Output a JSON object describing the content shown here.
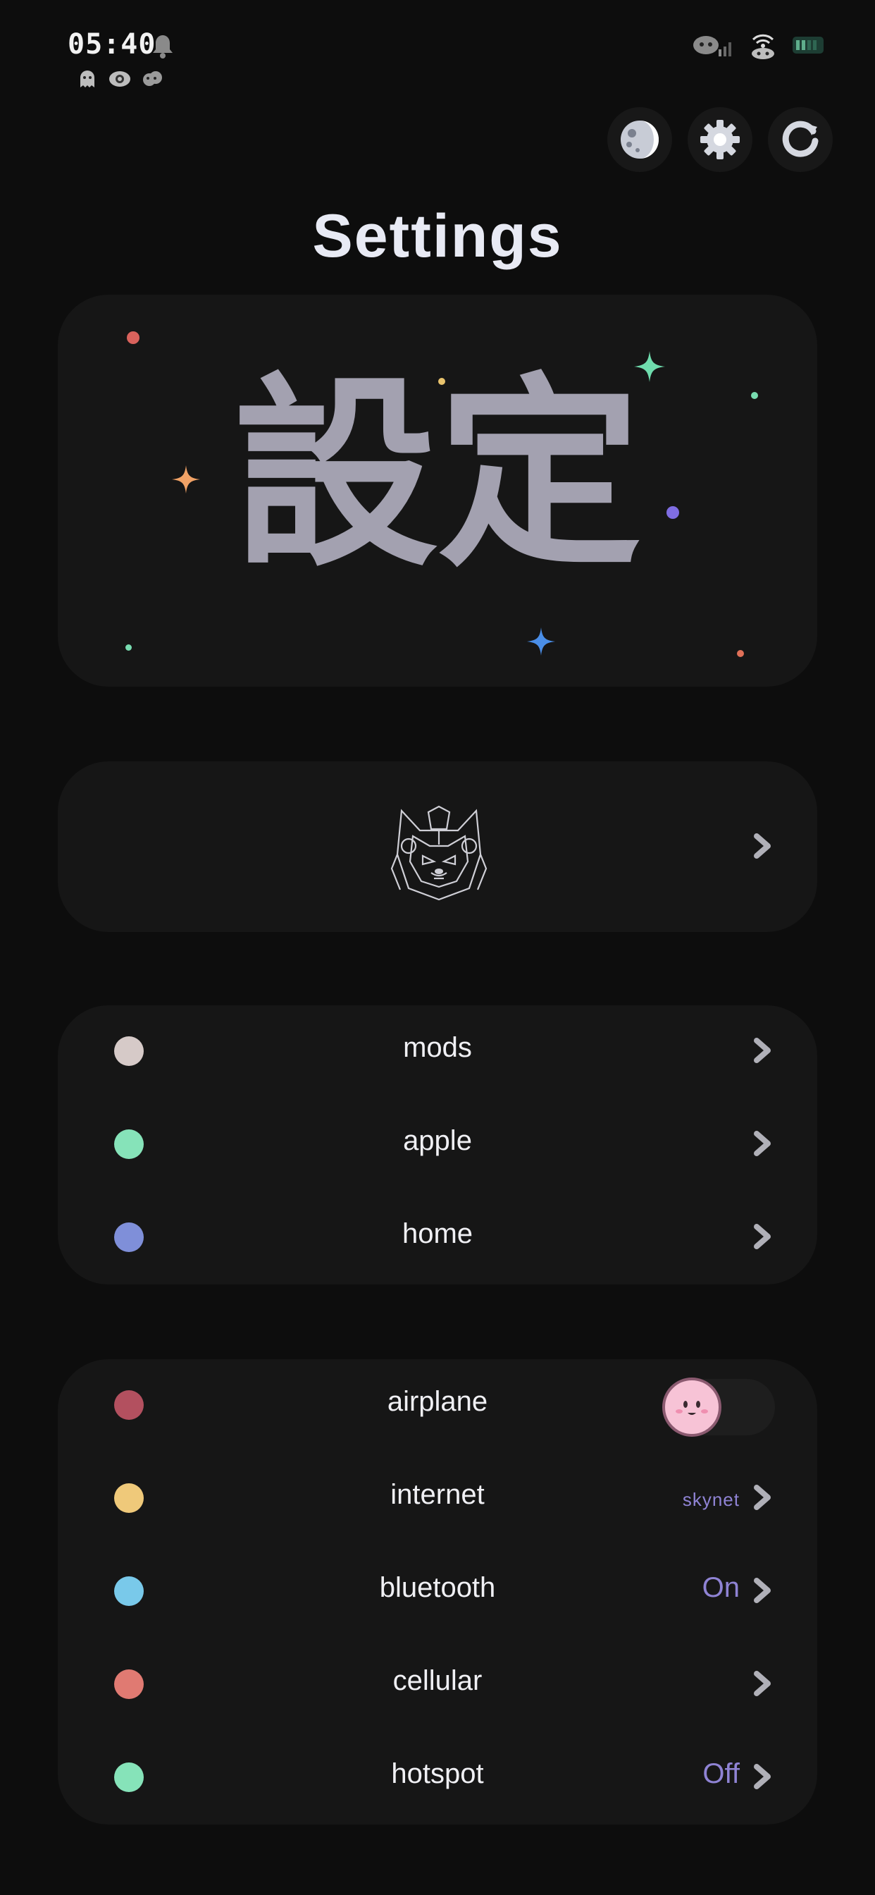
{
  "status_bar": {
    "time": "05:40",
    "icons": [
      "bell-icon",
      "signal-icon",
      "wifi-icon",
      "battery-icon"
    ],
    "notification_icons": [
      "ghost-icon",
      "eye-icon",
      "cloud-icon"
    ]
  },
  "top_actions": [
    {
      "name": "theme-moon-button",
      "icon": "moon-icon"
    },
    {
      "name": "settings-button",
      "icon": "gear-icon"
    },
    {
      "name": "refresh-button",
      "icon": "refresh-icon"
    }
  ],
  "page_title": "Settings",
  "hero": {
    "kanji": "設定"
  },
  "profile": {
    "icon": "shiba-robot-avatar-icon"
  },
  "group1": [
    {
      "label": "mods",
      "color": "#d6cac8"
    },
    {
      "label": "apple",
      "color": "#86e3b9"
    },
    {
      "label": "home",
      "color": "#7f8fd9"
    }
  ],
  "group2": [
    {
      "label": "airplane",
      "color": "#b3505f",
      "control": "toggle",
      "toggle_on": false
    },
    {
      "label": "internet",
      "color": "#efc97a",
      "value": "skynet"
    },
    {
      "label": "bluetooth",
      "color": "#79c9ea",
      "value": "On"
    },
    {
      "label": "cellular",
      "color": "#e07a72",
      "value": ""
    },
    {
      "label": "hotspot",
      "color": "#86e3b9",
      "value": "Off"
    }
  ],
  "colors": {
    "background": "#0d0d0d",
    "card": "#161616",
    "accent_value": "#8f83d4",
    "kanji": "#a3a1b0"
  }
}
